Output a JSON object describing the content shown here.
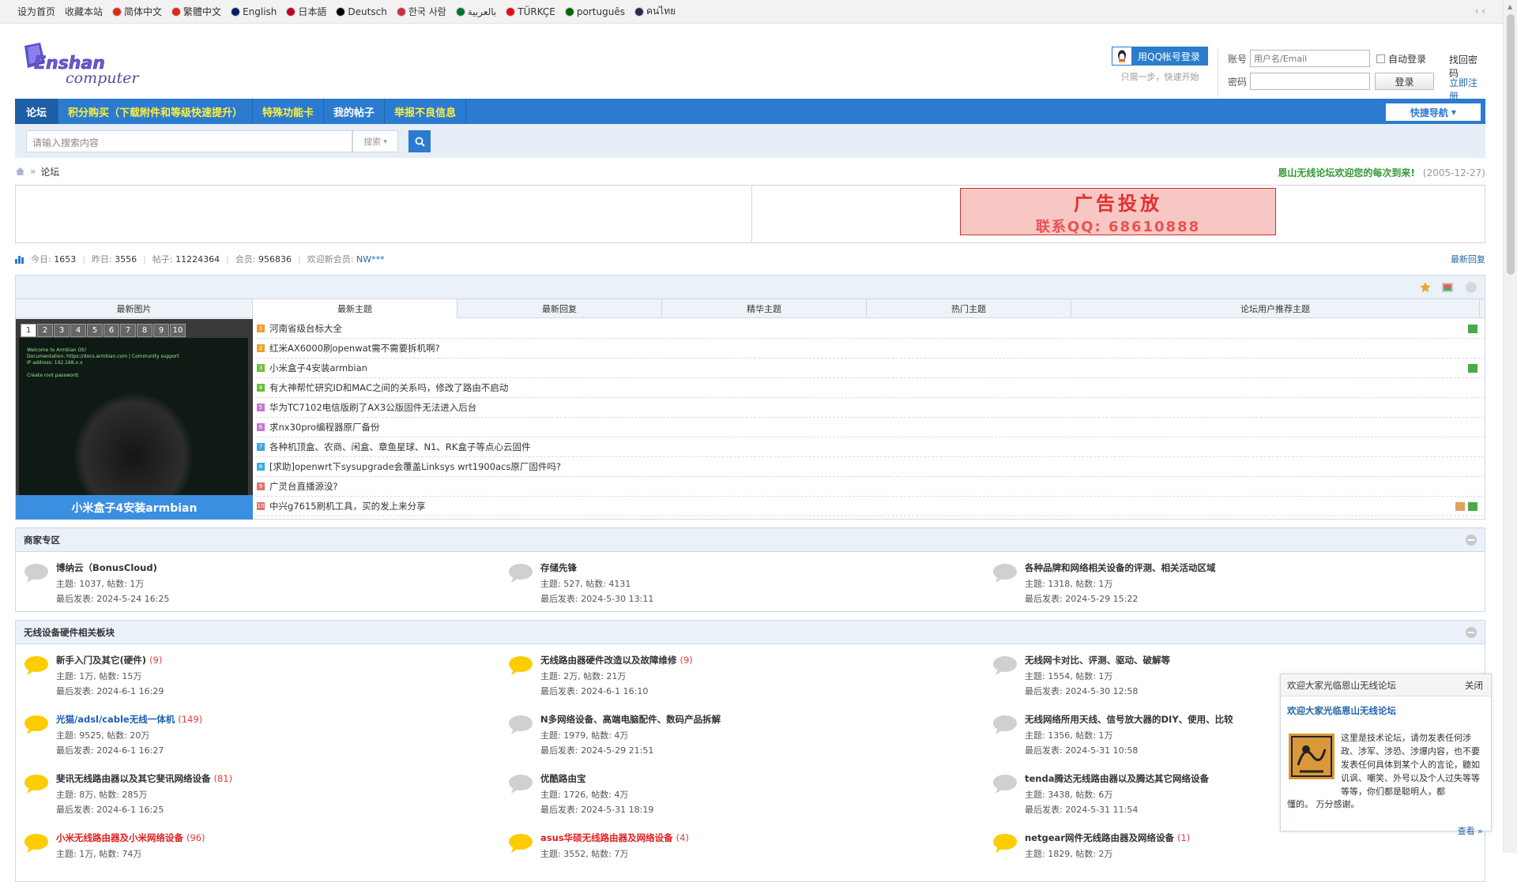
{
  "topbar": {
    "links": [
      "设为首页",
      "收藏本站"
    ],
    "languages": [
      {
        "label": "简体中文",
        "color": "#de2910"
      },
      {
        "label": "繁體中文",
        "color": "#de2910"
      },
      {
        "label": "English",
        "color": "#012169"
      },
      {
        "label": "日本語",
        "color": "#bc002d"
      },
      {
        "label": "Deutsch",
        "color": "#000000"
      },
      {
        "label": "한국 사람",
        "color": "#cd2e3a"
      },
      {
        "label": "بالعربية",
        "color": "#00732f"
      },
      {
        "label": "TÜRKÇE",
        "color": "#e30a17"
      },
      {
        "label": "português",
        "color": "#006600"
      },
      {
        "label": "คนไทย",
        "color": "#2d2a4a"
      }
    ],
    "right": "‹ ‹"
  },
  "header": {
    "logo_text_1": "Enshan",
    "logo_text_2": "computer",
    "qq_login": "用QQ帐号登录",
    "qq_sub": "只需一步，快速开始",
    "account_label": "账号",
    "account_placeholder": "用户名/Email",
    "password_label": "密码",
    "auto_login": "自动登录",
    "login_button": "登录",
    "find_password": "找回密码",
    "register": "立即注册"
  },
  "nav": {
    "items": [
      "论坛",
      "积分购买（下载附件和等级快速提升）",
      "特殊功能卡",
      "我的帖子",
      "举报不良信息"
    ],
    "quick_nav": "快捷导航"
  },
  "search": {
    "placeholder": "请输入搜索内容",
    "type": "搜索"
  },
  "breadcrumb": {
    "sep": "»",
    "current": "论坛",
    "notice": "恩山无线论坛欢迎您的每次到来!",
    "notice_date": "(2005-12-27)"
  },
  "ad": {
    "line1": "广告投放",
    "line2": "联系QQ: 68610888"
  },
  "stats": {
    "today_label": "今日:",
    "today": "1653",
    "yesterday_label": "昨日:",
    "yesterday": "3556",
    "posts_label": "帖子:",
    "posts": "11224364",
    "members_label": "会员:",
    "members": "956836",
    "newest_label": "欢迎新会员:",
    "newest": "NW***",
    "latest_reply": "最新回复"
  },
  "portal": {
    "tabs": [
      "最新图片",
      "最新主题",
      "最新回复",
      "精华主题",
      "热门主题",
      "论坛用户推荐主题"
    ],
    "slide_numbers": [
      "1",
      "2",
      "3",
      "4",
      "5",
      "6",
      "7",
      "8",
      "9",
      "10"
    ],
    "slide_caption": "小米盒子4安装armbian",
    "topics": [
      {
        "n": "1",
        "title": "河南省级台标大全",
        "color": "#f0a030"
      },
      {
        "n": "2",
        "title": "红米AX6000刷openwat需不需要拆机啊?",
        "color": "#f0a030"
      },
      {
        "n": "3",
        "title": "小米盒子4安装armbian",
        "color": "#6cbf3c"
      },
      {
        "n": "4",
        "title": "有大神帮忙研究ID和MAC之间的关系吗，修改了路由不启动",
        "color": "#6cbf3c"
      },
      {
        "n": "5",
        "title": "华为TC7102电信版刷了AX3公版固件无法进入后台",
        "color": "#c077d8"
      },
      {
        "n": "6",
        "title": "求nx30pro编程器原厂备份",
        "color": "#c077d8"
      },
      {
        "n": "7",
        "title": "各种机顶盒、农商、闲盒、章鱼星球、N1、RK盒子等点心云固件",
        "color": "#3aa8e0"
      },
      {
        "n": "8",
        "title": "[求助]openwrt下sysupgrade会覆盖Linksys wrt1900acs原厂固件吗?",
        "color": "#3aa8e0"
      },
      {
        "n": "9",
        "title": "广灵台直播源没?",
        "color": "#e07070"
      },
      {
        "n": "10",
        "title": "中兴g7615刷机工具，买的发上来分享",
        "color": "#e07070"
      }
    ]
  },
  "sections": [
    {
      "title": "商家专区",
      "forums": [
        {
          "name": "博纳云（BonusCloud)",
          "new": "",
          "topics": "主题: 1037, 帖数: 1万",
          "last": "最后发表: 2024-5-24 16:25",
          "active": false,
          "color": ""
        },
        {
          "name": "存储先锋",
          "new": "",
          "topics": "主题: 527, 帖数: 4131",
          "last": "最后发表: 2024-5-30 13:11",
          "active": false,
          "color": ""
        },
        {
          "name": "各种品牌和网络相关设备的评测、相关活动区域",
          "new": "",
          "topics": "主题: 1318, 帖数: 1万",
          "last": "最后发表: 2024-5-29 15:22",
          "active": false,
          "color": ""
        }
      ]
    },
    {
      "title": "无线设备硬件相关板块",
      "forums": [
        {
          "name": "新手入门及其它(硬件)",
          "new": "(9)",
          "topics": "主题: 1万, 帖数: 15万",
          "last": "最后发表: 2024-6-1 16:29",
          "active": true,
          "color": ""
        },
        {
          "name": "无线路由器硬件改造以及故障维修",
          "new": "(9)",
          "topics": "主题: 2万, 帖数: 21万",
          "last": "最后发表: 2024-6-1 16:10",
          "active": true,
          "color": ""
        },
        {
          "name": "无线网卡对比、评测、驱动、破解等",
          "new": "",
          "topics": "主题: 1554, 帖数: 1万",
          "last": "最后发表: 2024-5-30 12:58",
          "active": false,
          "color": ""
        },
        {
          "name": "光猫/adsl/cable无线一体机",
          "new": "(149)",
          "topics": "主题: 9525, 帖数: 20万",
          "last": "最后发表: 2024-6-1 16:27",
          "active": true,
          "color": "#1a5fb4"
        },
        {
          "name": "N多网络设备、高端电脑配件、数码产品拆解",
          "new": "",
          "topics": "主题: 1979, 帖数: 4万",
          "last": "最后发表: 2024-5-29 21:51",
          "active": false,
          "color": ""
        },
        {
          "name": "无线网络所用天线、信号放大器的DIY、使用、比较",
          "new": "",
          "topics": "主题: 1356, 帖数: 1万",
          "last": "最后发表: 2024-5-31 10:58",
          "active": false,
          "color": ""
        },
        {
          "name": "斐讯无线路由器以及其它斐讯网络设备",
          "new": "(81)",
          "topics": "主题: 8万, 帖数: 285万",
          "last": "最后发表: 2024-6-1 16:25",
          "active": true,
          "color": ""
        },
        {
          "name": "优酷路由宝",
          "new": "",
          "topics": "主题: 1726, 帖数: 4万",
          "last": "最后发表: 2024-5-31 18:19",
          "active": false,
          "color": ""
        },
        {
          "name": "tenda腾达无线路由器以及腾达其它网络设备",
          "new": "",
          "topics": "主题: 3438, 帖数: 6万",
          "last": "最后发表: 2024-5-31 11:54",
          "active": false,
          "color": ""
        },
        {
          "name": "小米无线路由器及小米网络设备",
          "new": "(96)",
          "topics": "主题: 1万, 帖数: 74万",
          "last": "",
          "active": true,
          "color": "#e02020"
        },
        {
          "name": "asus华硕无线路由器及网络设备",
          "new": "(4)",
          "topics": "主题: 3552, 帖数: 7万",
          "last": "",
          "active": true,
          "color": "#e02020"
        },
        {
          "name": "netgear网件无线路由器及网络设备",
          "new": "(1)",
          "topics": "主题: 1829, 帖数: 2万",
          "last": "",
          "active": true,
          "color": ""
        }
      ]
    }
  ],
  "popup": {
    "header": "欢迎大家光临恩山无线论坛",
    "close": "关闭",
    "title": "欢迎大家光临恩山无线论坛",
    "body": "这里是技术论坛，请勿发表任何涉政、涉军、涉恐、涉爆内容，也不要发表任何具体到某个人的言论，聽如讥讽、嘲笑、外号以及个人过失等等等等，你们都是聪明人，都",
    "body2": "懂的。 万分感谢。",
    "more": "查看 »"
  },
  "colors": {
    "nav_bg": "#2b7bd1",
    "nav_highlight": "#ffef3c",
    "link_blue": "#2366a8",
    "notice_green": "#339933",
    "new_count_red": "#e03c3c",
    "active_bubble": "#ffcc00",
    "inactive_bubble": "#d0d0d0"
  }
}
